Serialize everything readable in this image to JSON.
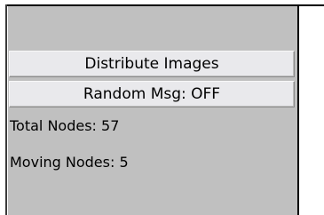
{
  "controls": {
    "distribute_label": "Distribute Images",
    "random_msg_label": "Random Msg: OFF"
  },
  "stats": {
    "total_nodes_text": "Total Nodes: 57",
    "moving_nodes_text": "Moving Nodes: 5"
  },
  "colors": {
    "panel_background": "#c0c0c0",
    "button_background": "#e9e9ec",
    "border": "#000000"
  }
}
